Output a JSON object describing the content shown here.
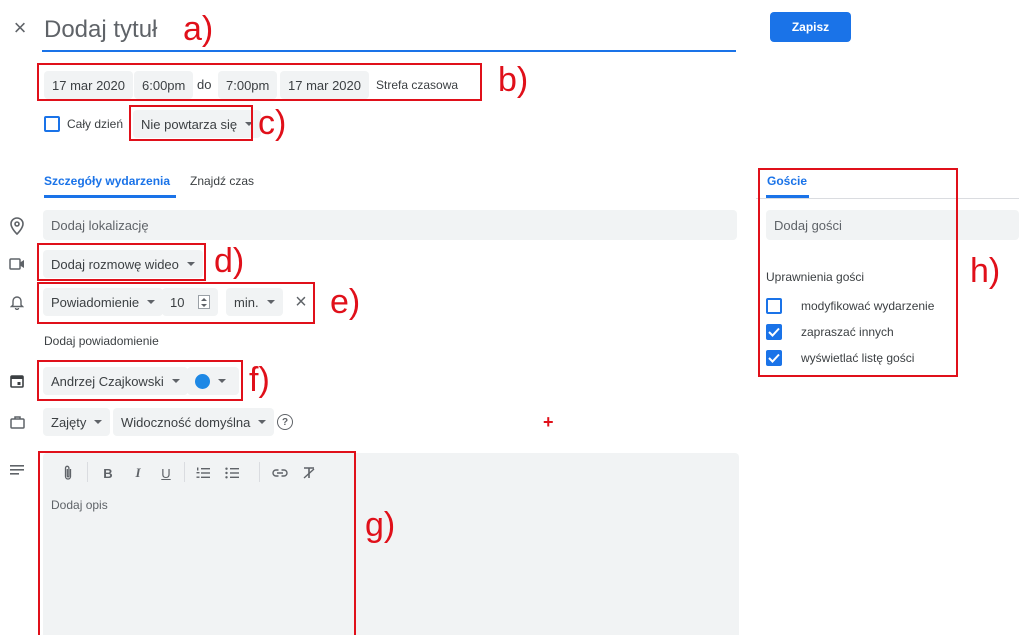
{
  "header": {
    "close_icon": "×",
    "title_placeholder": "Dodaj tytuł",
    "save_label": "Zapisz"
  },
  "datetime": {
    "start_date": "17 mar 2020",
    "start_time": "6:00pm",
    "separator": "do",
    "end_time": "7:00pm",
    "end_date": "17 mar 2020",
    "timezone": "Strefa czasowa"
  },
  "allday": {
    "label": "Cały dzień",
    "checked": false
  },
  "repeat": {
    "label": "Nie powtarza się"
  },
  "tabs": {
    "details": "Szczegóły wydarzenia",
    "find_time": "Znajdź czas",
    "guests": "Goście"
  },
  "details": {
    "location_placeholder": "Dodaj lokalizację",
    "video_label": "Dodaj rozmowę wideo",
    "notification_type": "Powiadomienie",
    "notification_value": "10",
    "notification_unit": "min.",
    "add_notification": "Dodaj powiadomienie",
    "calendar_owner": "Andrzej Czajkowski",
    "calendar_color": "#1e88e5",
    "busy_label": "Zajęty",
    "visibility_label": "Widoczność domyślna",
    "help_icon": "?",
    "description_placeholder": "Dodaj opis"
  },
  "toolbar": {
    "bold": "B",
    "italic": "I",
    "underline": "U"
  },
  "guests": {
    "add_placeholder": "Dodaj gości",
    "permissions_title": "Uprawnienia gości",
    "permissions": [
      {
        "label": "modyfikować wydarzenie",
        "checked": false
      },
      {
        "label": "zapraszać innych",
        "checked": true
      },
      {
        "label": "wyświetlać listę gości",
        "checked": true
      }
    ]
  },
  "annotations": {
    "a": "a)",
    "b": "b)",
    "c": "c)",
    "d": "d)",
    "e": "e)",
    "f": "f)",
    "g": "g)",
    "h": "h)",
    "plus": "+"
  },
  "colors": {
    "accent": "#1a73e8",
    "annotation": "#e0101a",
    "field_bg": "#f1f3f4"
  }
}
